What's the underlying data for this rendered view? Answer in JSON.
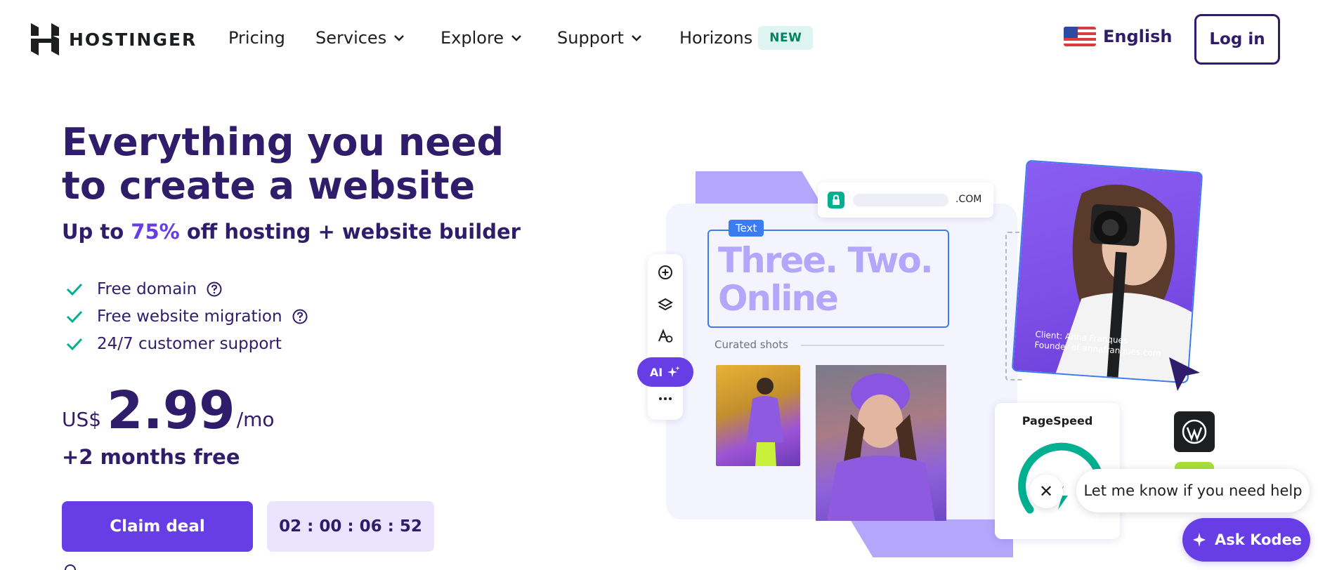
{
  "brand": {
    "name": "HOSTINGER"
  },
  "nav": {
    "pricing": "Pricing",
    "services": "Services",
    "explore": "Explore",
    "support": "Support",
    "horizons": "Horizons",
    "horizons_badge": "NEW",
    "language": "English",
    "login": "Log in"
  },
  "hero": {
    "title": "Everything you need to create a website",
    "subtitle_pre": "Up to ",
    "subtitle_highlight": "75%",
    "subtitle_post": " off hosting + website builder",
    "features": [
      "Free domain",
      "Free website migration",
      "24/7 customer support"
    ],
    "price_currency": "US$",
    "price_amount": "2.99",
    "price_period": "/mo",
    "bonus": "+2 months free",
    "cta": "Claim deal",
    "timer": "02 : 00 : 06 : 52"
  },
  "illustration": {
    "url_tld": ".COM",
    "text_tag": "Text",
    "headline": "Three. Two. Online",
    "curated": "Curated shots",
    "client_name": "Client: Anna Franques",
    "client_role": "Founder of annafranques.com",
    "ai_label": "AI",
    "pagespeed": "PageSpeed"
  },
  "chat": {
    "help_text": "Let me know if you need help",
    "close": "✕",
    "kodee": "Ask Kodee"
  },
  "colors": {
    "primary": "#673de6",
    "navy": "#2f1c6a",
    "accent_light": "#ebe4ff",
    "green": "#00b090"
  }
}
